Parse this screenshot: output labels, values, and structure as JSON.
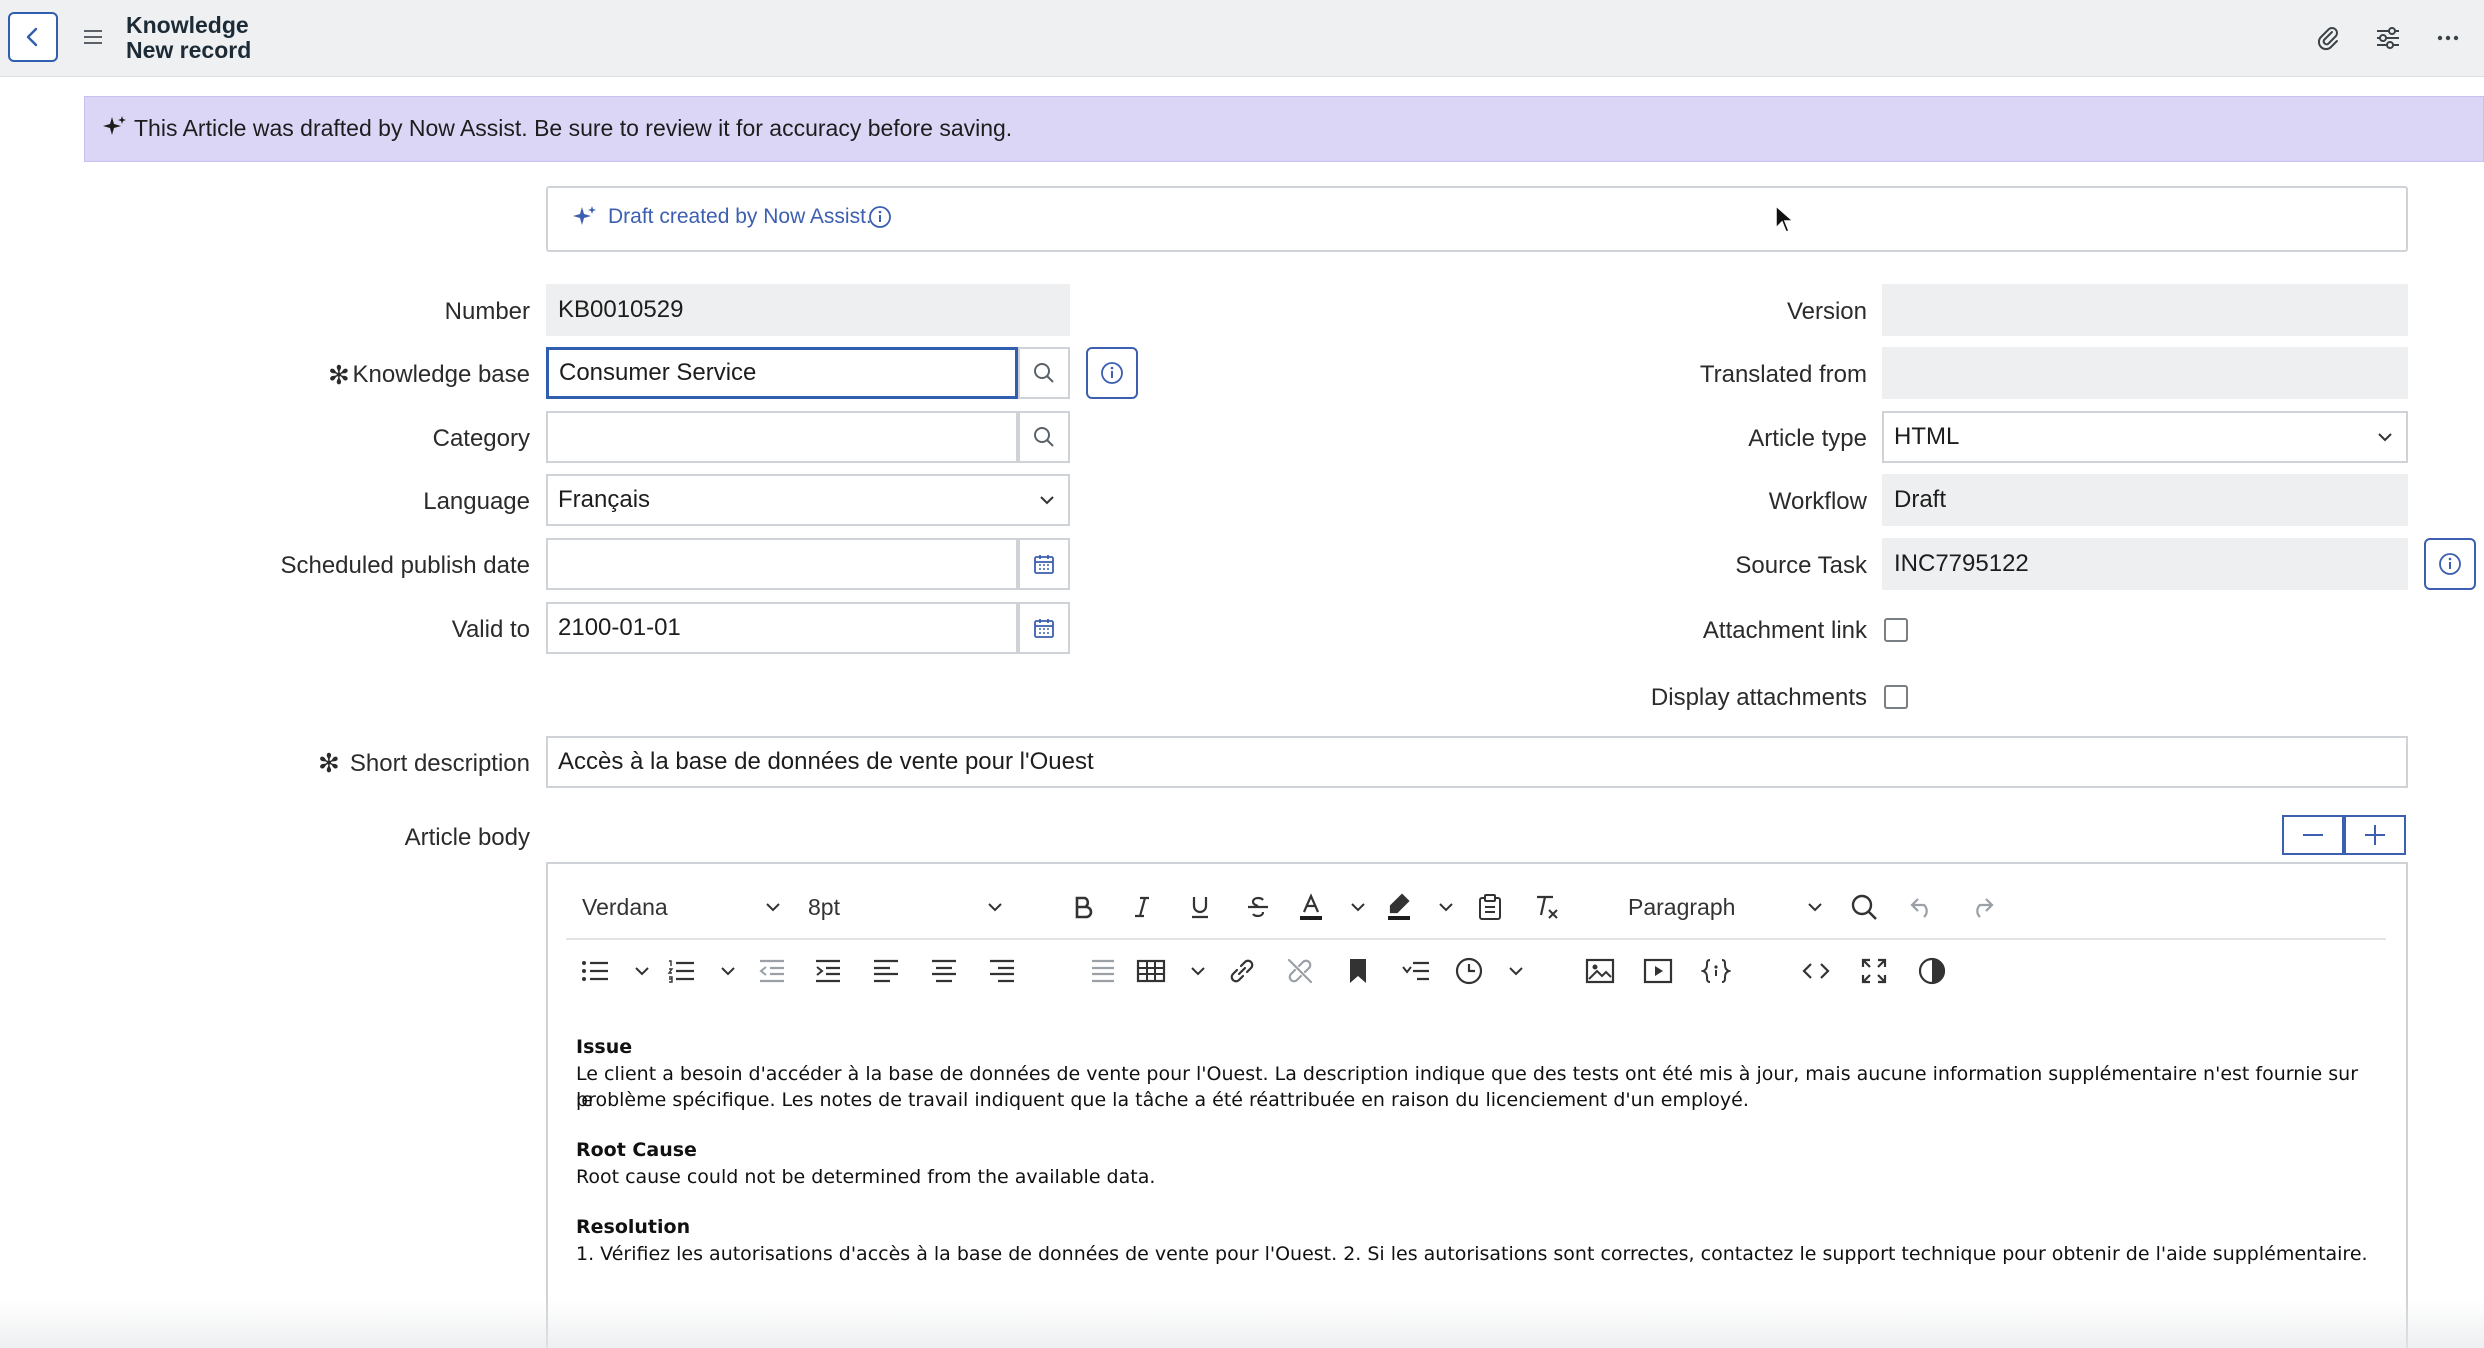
{
  "header": {
    "title_line1": "Knowledge",
    "title_line2": "New record",
    "icons": [
      "back-icon",
      "menu-icon",
      "attachment-icon",
      "settings-sliders-icon",
      "more-icon"
    ]
  },
  "banner": {
    "text": "This Article was drafted by Now Assist. Be sure to review it for accuracy before saving."
  },
  "draft_notice": {
    "text": "Draft created by Now Assist."
  },
  "form": {
    "number": {
      "label": "Number",
      "value": "KB0010529"
    },
    "knowledge_base": {
      "label": "Knowledge base",
      "value": "Consumer Service"
    },
    "category": {
      "label": "Category",
      "value": ""
    },
    "language": {
      "label": "Language",
      "value": "Français"
    },
    "scheduled_publish_date": {
      "label": "Scheduled publish date",
      "value": ""
    },
    "valid_to": {
      "label": "Valid to",
      "value": "2100-01-01"
    },
    "version": {
      "label": "Version",
      "value": ""
    },
    "translated_from": {
      "label": "Translated from",
      "value": ""
    },
    "article_type": {
      "label": "Article type",
      "value": "HTML"
    },
    "workflow": {
      "label": "Workflow",
      "value": "Draft"
    },
    "source_task": {
      "label": "Source Task",
      "value": "INC7795122"
    },
    "attachment_link": {
      "label": "Attachment link",
      "checked": false
    },
    "display_attachments": {
      "label": "Display attachments",
      "checked": false
    },
    "short_description": {
      "label": "Short description",
      "value": "Accès à la base de données de vente pour l'Ouest"
    },
    "article_body": {
      "label": "Article body"
    },
    "required_mark": "✻"
  },
  "editor": {
    "font_family": "Verdana",
    "font_size": "8pt",
    "block_format": "Paragraph",
    "content": {
      "issue_heading": "Issue",
      "issue_line1": "Le client a besoin d'accéder à la base de données de vente pour l'Ouest. La description indique que des tests ont été mis à jour, mais aucune information supplémentaire n'est fournie sur le",
      "issue_line2": "problème spécifique. Les notes de travail indiquent que la tâche a été réattribuée en raison du licenciement d'un employé.",
      "root_heading": "Root Cause",
      "root_text": "Root cause could not be determined from the available data.",
      "resolution_heading": "Resolution",
      "resolution_text": "1. Vérifiez les autorisations d'accès à la base de données de vente pour l'Ouest. 2. Si les autorisations sont correctes, contactez le support technique pour obtenir de l'aide supplémentaire."
    }
  },
  "colors": {
    "accent": "#2f5fae",
    "banner_bg": "#dcd6f6",
    "readonly_bg": "#eeeff0",
    "header_bg": "#eef0f1"
  }
}
